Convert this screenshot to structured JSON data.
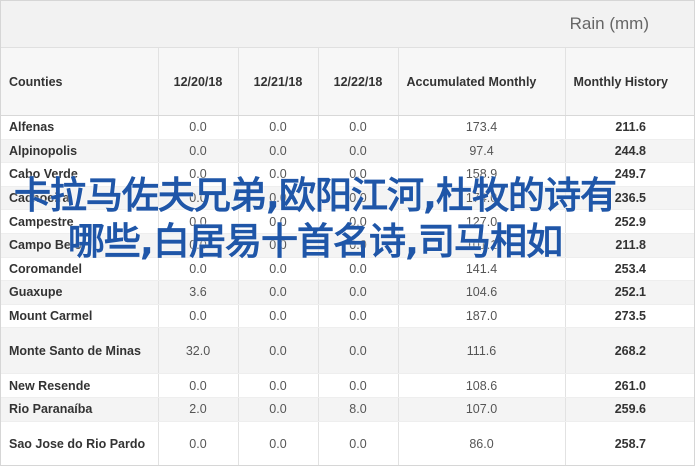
{
  "header": {
    "unit_title": "Rain (mm)"
  },
  "table": {
    "columns": [
      "Counties",
      "12/20/18",
      "12/21/18",
      "12/22/18",
      "Accumulated Monthly",
      "Monthly History"
    ],
    "rows": [
      {
        "name": "Alfenas",
        "d1": "0.0",
        "d2": "0.0",
        "d3": "0.0",
        "acc": "173.4",
        "hist": "211.6"
      },
      {
        "name": "Alpinopolis",
        "d1": "0.0",
        "d2": "0.0",
        "d3": "0.0",
        "acc": "97.4",
        "hist": "244.8"
      },
      {
        "name": "Cabo Verde",
        "d1": "0.0",
        "d2": "0.0",
        "d3": "0.0",
        "acc": "158.9",
        "hist": "249.7"
      },
      {
        "name": "Cachoeira",
        "d1": "0.0",
        "d2": "0.0",
        "d3": "0.0",
        "acc": "174.0",
        "hist": "236.5"
      },
      {
        "name": "Campestre",
        "d1": "0.0",
        "d2": "0.0",
        "d3": "0.0",
        "acc": "127.0",
        "hist": "252.9"
      },
      {
        "name": "Campo Belo",
        "d1": "0.0",
        "d2": "0.0",
        "d3": "0.0",
        "acc": "101.1",
        "hist": "211.8"
      },
      {
        "name": "Coromandel",
        "d1": "0.0",
        "d2": "0.0",
        "d3": "0.0",
        "acc": "141.4",
        "hist": "253.4"
      },
      {
        "name": "Guaxupe",
        "d1": "3.6",
        "d2": "0.0",
        "d3": "0.0",
        "acc": "104.6",
        "hist": "252.1"
      },
      {
        "name": "Mount Carmel",
        "d1": "0.0",
        "d2": "0.0",
        "d3": "0.0",
        "acc": "187.0",
        "hist": "273.5"
      },
      {
        "name": "Monte Santo de Minas",
        "d1": "32.0",
        "d2": "0.0",
        "d3": "0.0",
        "acc": "111.6",
        "hist": "268.2"
      },
      {
        "name": "New Resende",
        "d1": "0.0",
        "d2": "0.0",
        "d3": "0.0",
        "acc": "108.6",
        "hist": "261.0"
      },
      {
        "name": "Rio Paranaíba",
        "d1": "2.0",
        "d2": "0.0",
        "d3": "8.0",
        "acc": "107.0",
        "hist": "259.6"
      },
      {
        "name": "Sao Jose do Rio Pardo",
        "d1": "0.0",
        "d2": "0.0",
        "d3": "0.0",
        "acc": "86.0",
        "hist": "258.7"
      }
    ]
  },
  "overlay": {
    "text": "卡拉马佐夫兄弟,欧阳江河,杜牧的诗有哪些,白居易十首名诗,司马相如"
  }
}
